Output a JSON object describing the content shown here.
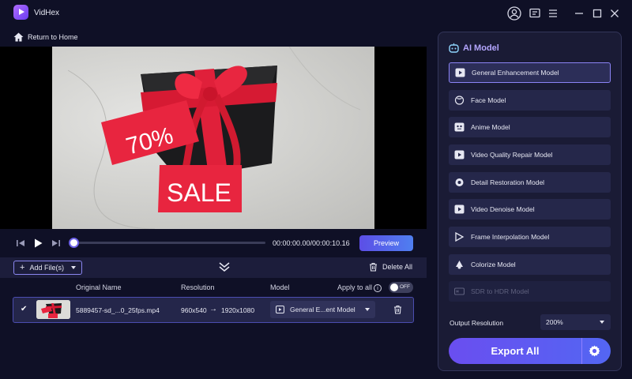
{
  "app": {
    "title": "VidHex"
  },
  "nav": {
    "back_label": "Return to Home"
  },
  "player": {
    "timecode": "00:00:00.00/00:00:10.16",
    "preview_label": "Preview",
    "progress": 0,
    "frame_text": {
      "percent": "70%",
      "sale": "SALE"
    }
  },
  "filelist": {
    "add_label": "Add File(s)",
    "delete_all_label": "Delete All",
    "headers": {
      "name": "Original Name",
      "resolution": "Resolution",
      "model": "Model",
      "apply_all": "Apply to all"
    },
    "apply_all_toggle": "OFF",
    "rows": [
      {
        "name": "5889457-sd_...0_25fps.mp4",
        "res_from": "960x540",
        "res_to": "1920x1080",
        "model": "General E...ent Model",
        "checked": true
      }
    ]
  },
  "ai_panel": {
    "title": "AI Model",
    "models": [
      {
        "label": "General Enhancement Model",
        "icon": "video-enhance-icon",
        "active": true
      },
      {
        "label": "Face Model",
        "icon": "face-icon"
      },
      {
        "label": "Anime Model",
        "icon": "anime-icon"
      },
      {
        "label": "Video Quality Repair Model",
        "icon": "video-repair-icon"
      },
      {
        "label": "Detail Restoration Model",
        "icon": "detail-restore-icon"
      },
      {
        "label": "Video Denoise Model",
        "icon": "denoise-icon"
      },
      {
        "label": "Frame Interpolation Model",
        "icon": "frame-interpolation-icon"
      },
      {
        "label": "Colorize Model",
        "icon": "colorize-icon"
      },
      {
        "label": "SDR to HDR Model",
        "icon": "hdr-icon",
        "disabled": true
      }
    ],
    "output_resolution_label": "Output Resolution",
    "output_resolution_value": "200%",
    "export_label": "Export All"
  },
  "colors": {
    "accent": "#6a4ef0",
    "background": "#0f1026",
    "panel": "#1a1b35"
  }
}
